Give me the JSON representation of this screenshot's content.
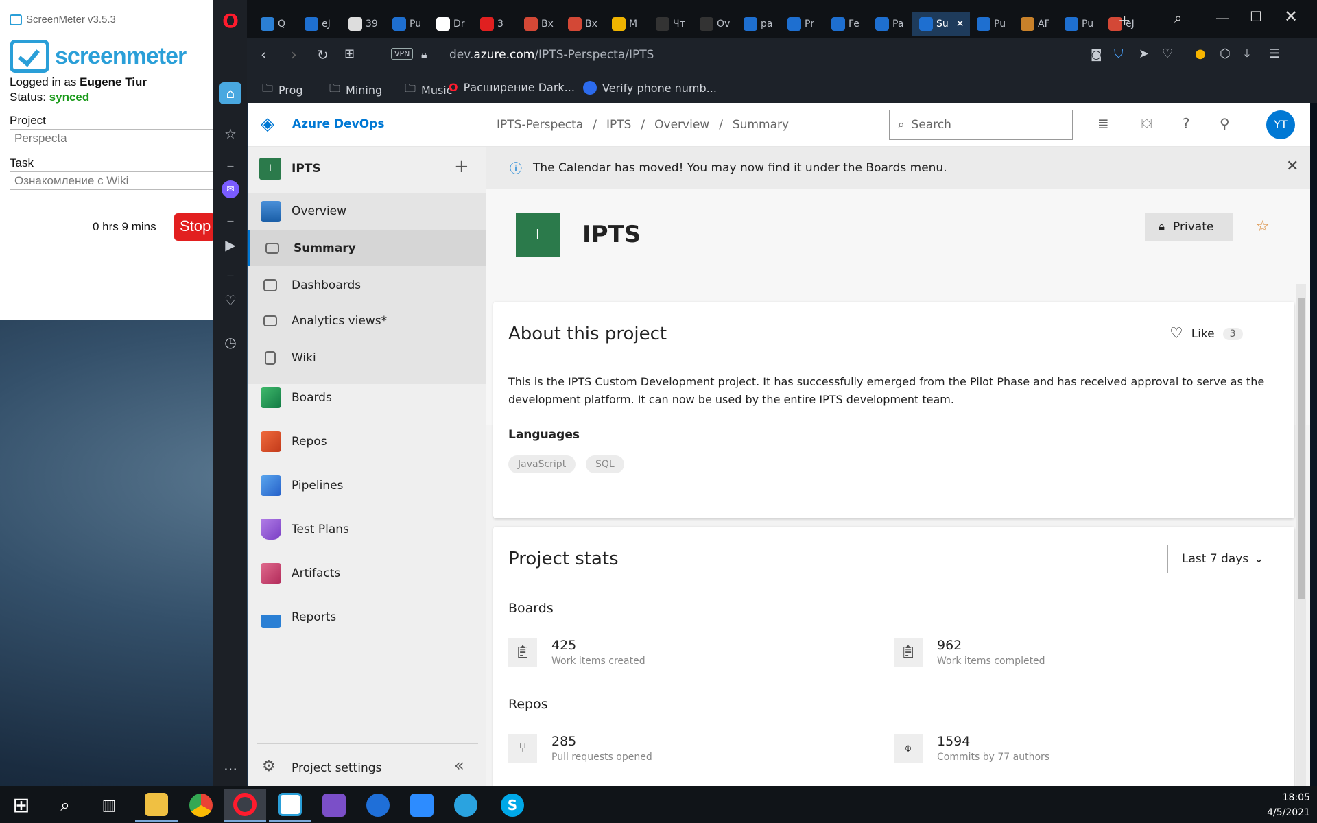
{
  "screenmeter": {
    "window_title": "ScreenMeter v3.5.3",
    "logo_text": "screenmeter",
    "logged_in_label": "Logged in as",
    "user": "Eugene Tiur",
    "status_label": "Status:",
    "status": "synced",
    "project_label": "Project",
    "project_value": "Perspecta",
    "task_label": "Task",
    "task_value": "Ознакомление с Wiki",
    "timer": "0 hrs 9 mins",
    "stop_label": "Stop",
    "status_color": "#1a9a1a"
  },
  "browser": {
    "tabs": [
      "Q",
      "eJ",
      "39",
      "Pu",
      "Dr",
      "3",
      "Bx",
      "Bx",
      "M",
      "Чт",
      "Ov",
      "pa",
      "Pr",
      "Fe",
      "Pa",
      "Su",
      "Pu",
      "AF",
      "Pu",
      "eJ"
    ],
    "active_tab": "Su",
    "vpn_label": "VPN",
    "url_host_prefix": "dev.",
    "url_host": "azure.com",
    "url_path": "/IPTS-Perspecta/IPTS",
    "bookmarks": [
      "Prog",
      "Mining",
      "Music",
      "Расширение Dark...",
      "Verify phone numb..."
    ]
  },
  "ado": {
    "brand": "Azure DevOps",
    "breadcrumb": [
      "IPTS-Perspecta",
      "IPTS",
      "Overview",
      "Summary"
    ],
    "search_placeholder": "Search",
    "avatar_initials": "YT",
    "project_initial": "I",
    "project_name": "IPTS",
    "nav": {
      "overview": "Overview",
      "summary": "Summary",
      "dashboards": "Dashboards",
      "analytics": "Analytics views*",
      "wiki": "Wiki",
      "boards": "Boards",
      "repos": "Repos",
      "pipelines": "Pipelines",
      "testplans": "Test Plans",
      "artifacts": "Artifacts",
      "reports": "Reports",
      "settings": "Project settings"
    },
    "banner": "The Calendar has moved! You may now find it under the Boards menu.",
    "private_label": "Private",
    "about": {
      "title": "About this project",
      "like_label": "Like",
      "like_count": "3",
      "description": "This is the IPTS Custom Development project.  It has successfully emerged from the Pilot Phase and has received approval to serve as the development platform.  It can now be used by the entire IPTS development team.",
      "languages_label": "Languages",
      "languages": [
        "JavaScript",
        "SQL"
      ]
    },
    "stats": {
      "title": "Project stats",
      "period": "Last 7 days",
      "boards_label": "Boards",
      "repos_label": "Repos",
      "items": [
        {
          "value": "425",
          "label": "Work items created"
        },
        {
          "value": "962",
          "label": "Work items completed"
        },
        {
          "value": "285",
          "label": "Pull requests opened"
        },
        {
          "value": "1594",
          "label": "Commits by 77 authors"
        }
      ]
    },
    "accent": "#0078d4"
  },
  "clock": {
    "time": "18:05",
    "date": "4/5/2021"
  }
}
